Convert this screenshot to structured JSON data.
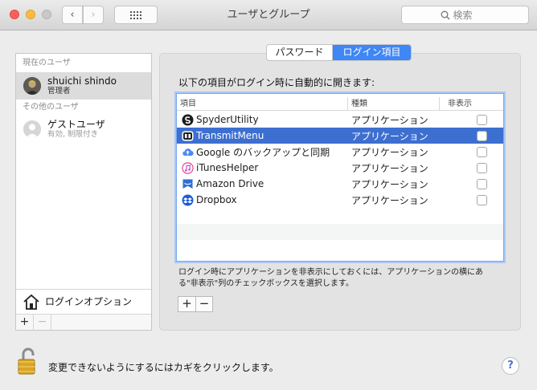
{
  "window": {
    "title": "ユーザとグループ"
  },
  "toolbar": {
    "back_label": "‹",
    "forward_label": "›"
  },
  "search": {
    "placeholder": "検索"
  },
  "sidebar": {
    "current_section": "現在のユーザ",
    "current_user": {
      "name": "shuichi shindo",
      "role": "管理者"
    },
    "other_section": "その他のユーザ",
    "guest_user": {
      "name": "ゲストユーザ",
      "status": "有効, 制限付き"
    },
    "login_options_label": "ログインオプション",
    "add_label": "+",
    "remove_label": "−"
  },
  "tabs": {
    "password": "パスワード",
    "login_items": "ログイン項目"
  },
  "main": {
    "heading": "以下の項目がログイン時に自動的に開きます:",
    "columns": {
      "item": "項目",
      "kind": "種類",
      "hide": "非表示"
    },
    "items": [
      {
        "name": "SpyderUtility",
        "kind": "アプリケーション",
        "icon": "spyder-icon"
      },
      {
        "name": "TransmitMenu",
        "kind": "アプリケーション",
        "icon": "transmit-icon"
      },
      {
        "name": "Google のバックアップと同期",
        "kind": "アプリケーション",
        "icon": "google-backup-icon"
      },
      {
        "name": "iTunesHelper",
        "kind": "アプリケーション",
        "icon": "itunes-icon"
      },
      {
        "name": "Amazon Drive",
        "kind": "アプリケーション",
        "icon": "amazon-drive-icon"
      },
      {
        "name": "Dropbox",
        "kind": "アプリケーション",
        "icon": "dropbox-icon"
      }
    ],
    "hint": "ログイン時にアプリケーションを非表示にしておくには、アプリケーションの横にある\"非表示\"列のチェックボックスを選択します。",
    "add_label": "+",
    "remove_label": "−"
  },
  "footer": {
    "lock_text": "変更できないようにするにはカギをクリックします。",
    "help_label": "?"
  },
  "colors": {
    "accent": "#3f86f7",
    "selection": "#3d6fd1"
  }
}
